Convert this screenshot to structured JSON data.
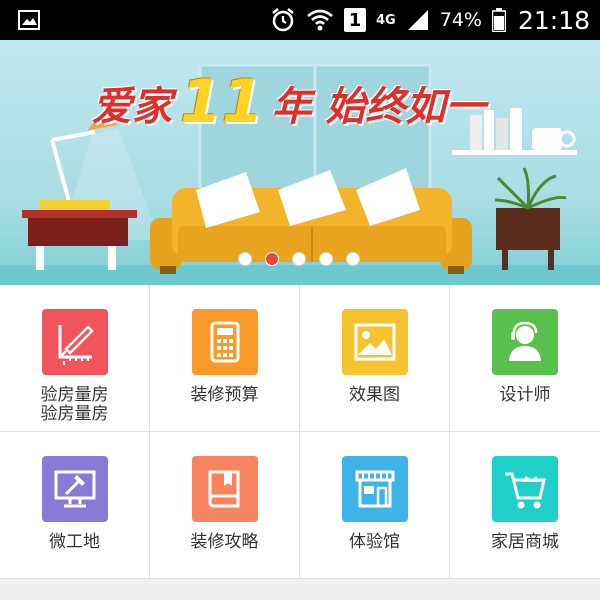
{
  "status_bar": {
    "gallery_icon": "image-icon",
    "alarm_icon": "alarm-clock-icon",
    "wifi_icon": "wifi-icon",
    "sim_label": "1",
    "network": "4G",
    "signal_icon": "signal-icon",
    "battery_percent": "74%",
    "battery_icon": "battery-icon",
    "time": "21:18"
  },
  "banner": {
    "title_part1": "爱家",
    "title_number": "11",
    "title_part2": "年 始终如一",
    "slides_total": 5,
    "active_slide": 2
  },
  "grid": {
    "items": [
      {
        "label": "验房量房",
        "label_line2": "验房量房",
        "color": "#f2545b",
        "icon": "measure-ruler-icon"
      },
      {
        "label": "装修预算",
        "label_line2": "",
        "color": "#f99a2b",
        "icon": "calculator-icon"
      },
      {
        "label": "效果图",
        "label_line2": "",
        "color": "#f6c22e",
        "icon": "picture-icon"
      },
      {
        "label": "设计师",
        "label_line2": "",
        "color": "#58c04d",
        "icon": "designer-person-icon"
      },
      {
        "label": "微工地",
        "label_line2": "",
        "color": "#8a7ad8",
        "icon": "monitor-hammer-icon"
      },
      {
        "label": "装修攻略",
        "label_line2": "",
        "color": "#f7845e",
        "icon": "book-icon"
      },
      {
        "label": "体验馆",
        "label_line2": "",
        "color": "#3fb3e8",
        "icon": "storefront-icon"
      },
      {
        "label": "家居商城",
        "label_line2": "",
        "color": "#1fcfca",
        "icon": "shopping-cart-icon"
      }
    ]
  }
}
